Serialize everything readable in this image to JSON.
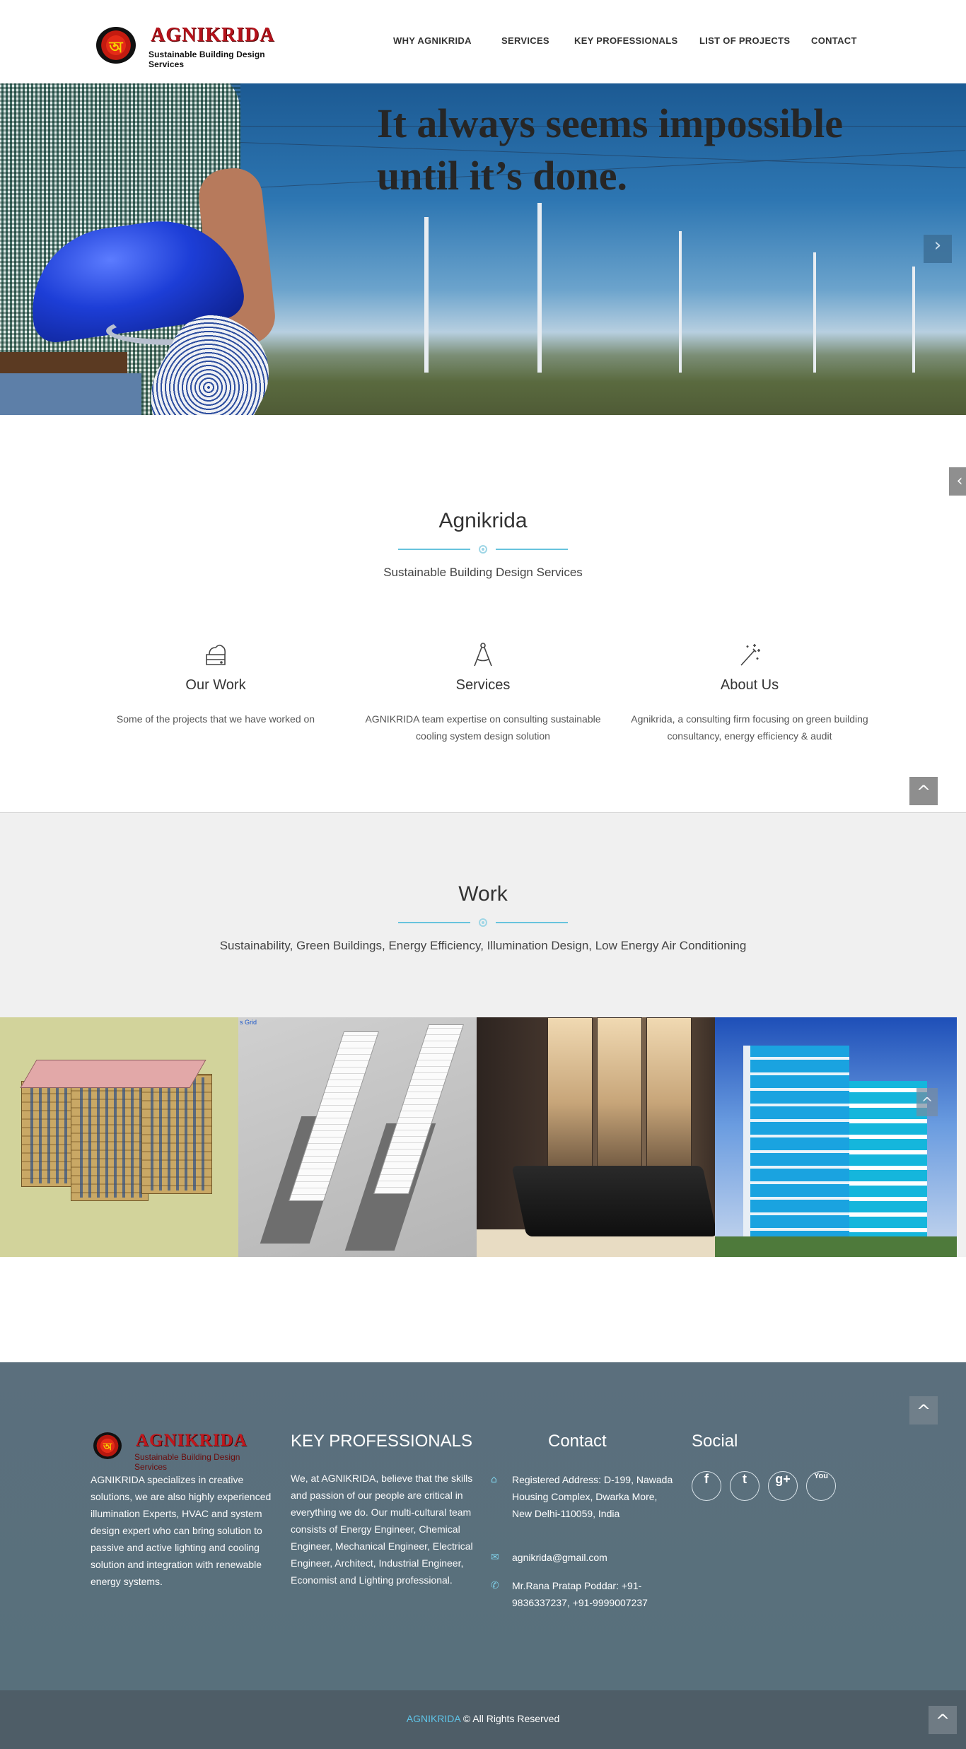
{
  "brand": {
    "name": "AGNIKRIDA",
    "tagline": "Sustainable Building Design Services",
    "mark": "অ"
  },
  "nav": {
    "items": [
      {
        "label": "WHY AGNIKRIDA"
      },
      {
        "label": "SERVICES"
      },
      {
        "label": "KEY PROFESSIONALS"
      },
      {
        "label": "LIST OF PROJECTS"
      },
      {
        "label": "CONTACT"
      }
    ]
  },
  "hero": {
    "quote_line1": "It always seems impossible",
    "quote_line2": "until it’s done.",
    "next_icon": "chevron-right-icon"
  },
  "intro": {
    "title": "Agnikrida",
    "subtitle": "Sustainable Building Design Services"
  },
  "features": [
    {
      "icon": "archive-icon",
      "title": "Our Work",
      "text": "Some of the projects that we have worked on"
    },
    {
      "icon": "compass-icon",
      "title": "Services",
      "text": "AGNIKRIDA team expertise on consulting sustainable cooling system design solution"
    },
    {
      "icon": "magic-wand-icon",
      "title": "About Us",
      "text": "Agnikrida, a consulting firm focusing on green building consultancy, energy efficiency & audit"
    }
  ],
  "work": {
    "title": "Work",
    "subtitle": "Sustainability, Green Buildings, Energy Efficiency, Illumination Design, Low Energy Air Conditioning",
    "tile2_caption": "s Grid"
  },
  "footer": {
    "about_text": "AGNIKRIDA specializes in creative solutions, we are also highly experienced illumination Experts, HVAC and system design expert who can bring solution to passive and active lighting and cooling solution and integration with renewable energy systems.",
    "professionals_title": "KEY PROFESSIONALS",
    "professionals_text": "We, at AGNIKRIDA, believe that the skills and passion of our people are critical in everything we do. Our multi-cultural team consists of Energy Engineer, Chemical Engineer, Mechanical Engineer, Electrical Engineer, Architect, Industrial Engineer, Economist and Lighting professional.",
    "contact_title": "Contact",
    "address": "Registered Address: D-199, Nawada Housing Complex, Dwarka More, New Delhi-110059, India",
    "email": "agnikrida@gmail.com",
    "phone": "Mr.Rana Pratap Poddar: +91-9836337237, +91-9999007237",
    "social_title": "Social",
    "social": [
      {
        "icon": "facebook-icon",
        "glyph": "f"
      },
      {
        "icon": "twitter-icon",
        "glyph": "t"
      },
      {
        "icon": "google-plus-icon",
        "glyph": "g+"
      },
      {
        "icon": "youtube-icon",
        "glyph": "You"
      }
    ]
  },
  "copyright": {
    "brand": "AGNIKRIDA",
    "text": " © All Rights Reserved"
  },
  "colors": {
    "accent": "#67c3dd",
    "brand_red": "#b5121b",
    "footer_bg": "#5b6f7d",
    "copyright_bg": "#4e5d67"
  }
}
